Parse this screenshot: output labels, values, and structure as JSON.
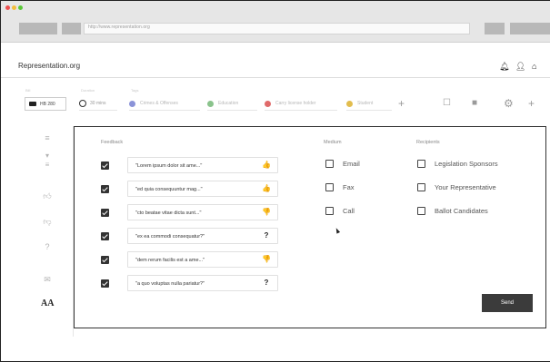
{
  "browser": {
    "url": "http://www.representation.org"
  },
  "header": {
    "site_title": "Representation.org",
    "icons": [
      "bell-icon",
      "user-icon",
      "home-icon"
    ]
  },
  "toolbar": {
    "bill_label": "Bill",
    "bill_value": "HB 280",
    "time_label": "Duration",
    "time_value": "30 mins",
    "tags_label": "Tags",
    "tags": [
      {
        "label": "Crimes & Offenses",
        "color": "#8b93d8"
      },
      {
        "label": "Education",
        "color": "#8ac38c"
      },
      {
        "label": "Carry license holder",
        "color": "#e06a6a"
      },
      {
        "label": "Student",
        "color": "#e2bd4e"
      }
    ]
  },
  "sidebar": {
    "icons": [
      "list-icon",
      "filter-list-icon",
      "thumbs-up-icon",
      "thumbs-down-icon",
      "question-icon",
      "mail-icon",
      "text-size-icon"
    ],
    "aa_label": "AA"
  },
  "main": {
    "feedback_header": "Feedback",
    "medium_header": "Medium",
    "recipients_header": "Recipients",
    "feedback": [
      {
        "text": "\"Lorem ipsum dolor sit ame...\"",
        "checked": true,
        "sentiment": "thumbs-up-icon",
        "glyph": "👍"
      },
      {
        "text": "\"ed quia consequuntur mag...\"",
        "checked": true,
        "sentiment": "thumbs-up-icon",
        "glyph": "👍"
      },
      {
        "text": "\"cto beatae vitae dicta sunt...\"",
        "checked": true,
        "sentiment": "thumbs-down-icon",
        "glyph": "👎"
      },
      {
        "text": "\"ex ea commodi consequatur?\"",
        "checked": true,
        "sentiment": "question-icon",
        "glyph": "?"
      },
      {
        "text": "\"dem rerum facilis est a ame...\"",
        "checked": true,
        "sentiment": "thumbs-down-icon",
        "glyph": "👎"
      },
      {
        "text": "\"a quo voluptas nulla pariatur?\"",
        "checked": true,
        "sentiment": "question-icon",
        "glyph": "?"
      }
    ],
    "medium": [
      {
        "label": "Email",
        "checked": false
      },
      {
        "label": "Fax",
        "checked": false
      },
      {
        "label": "Call",
        "checked": false
      }
    ],
    "recipients": [
      {
        "label": "Legislation Sponsors",
        "checked": false
      },
      {
        "label": "Your Representative",
        "checked": false
      },
      {
        "label": "Ballot Candidates",
        "checked": false
      }
    ],
    "send_label": "Send"
  }
}
